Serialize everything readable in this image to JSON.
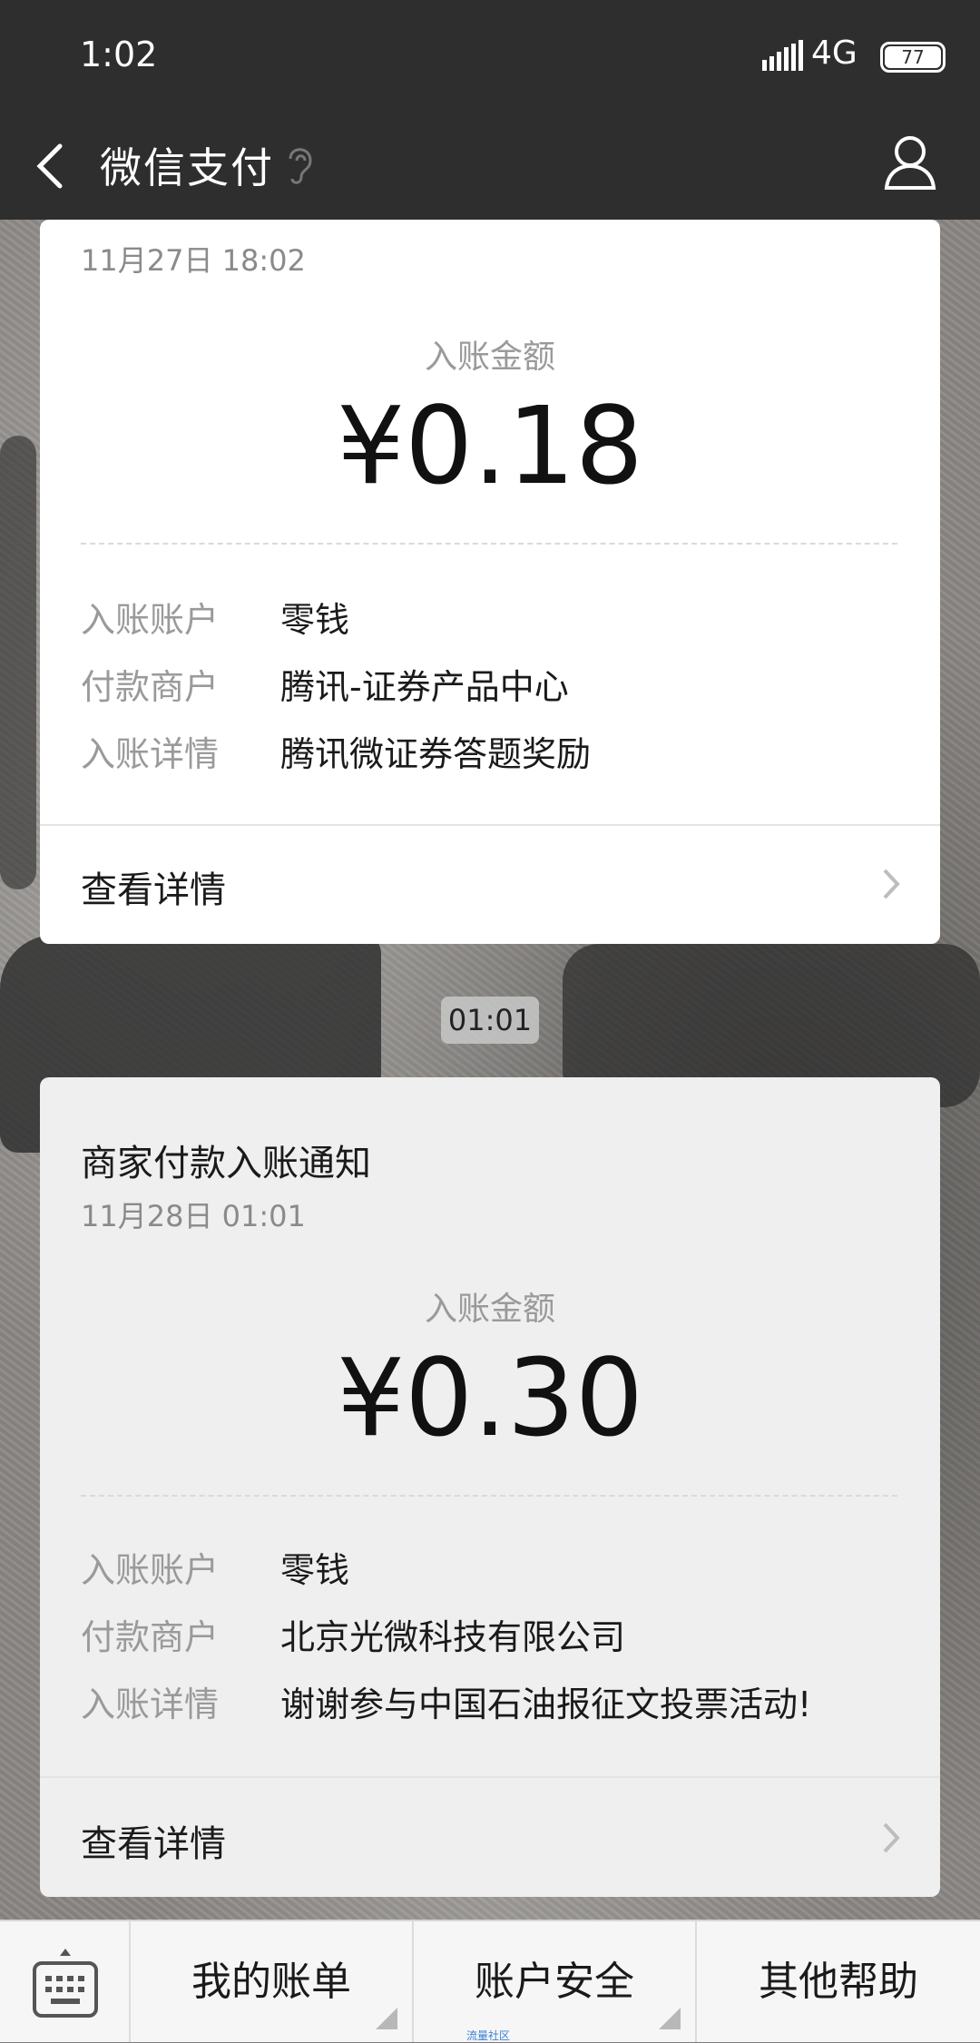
{
  "status_bar": {
    "time": "1:02",
    "network": "4G",
    "battery": "77"
  },
  "nav": {
    "title": "微信支付",
    "back_icon": "chevron-left-icon",
    "ear_icon": "ear-icon",
    "user_icon": "user-icon"
  },
  "cards": [
    {
      "date": "11月27日 18:02",
      "amount_label": "入账金额",
      "amount": "¥0.18",
      "rows": [
        {
          "label": "入账账户",
          "value": "零钱"
        },
        {
          "label": "付款商户",
          "value": "腾讯-证券产品中心"
        },
        {
          "label": "入账详情",
          "value": "腾讯微证券答题奖励"
        }
      ],
      "detail_link": "查看详情"
    },
    {
      "title": "商家付款入账通知",
      "date": "11月28日 01:01",
      "amount_label": "入账金额",
      "amount": "¥0.30",
      "rows": [
        {
          "label": "入账账户",
          "value": "零钱"
        },
        {
          "label": "付款商户",
          "value": "北京光微科技有限公司"
        },
        {
          "label": "入账详情",
          "value": "谢谢参与中国石油报征文投票活动!"
        }
      ],
      "detail_link": "查看详情"
    }
  ],
  "message_time": "01:01",
  "bottom_menu": [
    "我的账单",
    "账户安全",
    "其他帮助"
  ],
  "watermark": "流量社区",
  "colors": {
    "header_bg": "#2e2e2e",
    "card_bg": "#ffffff",
    "card_selected_bg": "#efefef"
  }
}
